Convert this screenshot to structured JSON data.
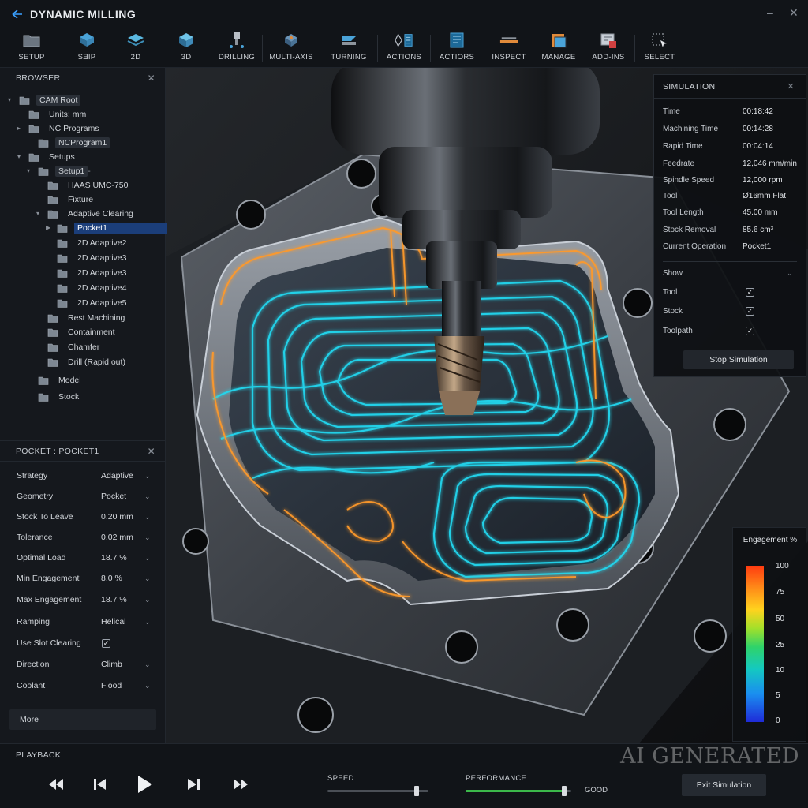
{
  "app": {
    "title": "DYNAMIC MILLING"
  },
  "toolbar": {
    "items": [
      {
        "label": "SETUP",
        "icon": "folder-icon"
      },
      {
        "label": "SƎIP",
        "icon": "stock-box-icon"
      },
      {
        "label": "2D",
        "icon": "2d-layer-icon"
      },
      {
        "label": "3D",
        "icon": "3d-cube-icon"
      },
      {
        "label": "DRILLING",
        "icon": "drill-icon"
      },
      {
        "label": "MULTI-AXIS",
        "icon": "multi-axis-icon"
      },
      {
        "label": "TURNING",
        "icon": "turning-icon"
      },
      {
        "label": "ACTIONS",
        "icon": "actions-icon"
      },
      {
        "label": "ACTIORS",
        "icon": "actions-panel-icon"
      },
      {
        "label": "INSPECT",
        "icon": "inspect-icon"
      },
      {
        "label": "MANAGE",
        "icon": "manage-icon"
      },
      {
        "label": "ADD-INS",
        "icon": "add-ins-icon"
      },
      {
        "label": "SELECT",
        "icon": "select-icon"
      }
    ]
  },
  "browser": {
    "title": "BROWSER",
    "tree": [
      {
        "label": "CAM Root",
        "depth": 0,
        "arrow": "▾",
        "boxed": true
      },
      {
        "label": "Units: mm",
        "depth": 1
      },
      {
        "label": "NC Programs",
        "depth": 1,
        "arrow": "▸"
      },
      {
        "label": "NCProgram1",
        "depth": 2,
        "boxed": true
      },
      {
        "label": "Setups",
        "depth": 1,
        "arrow": "▾"
      },
      {
        "label": "Setup1",
        "depth": 2,
        "arrow": "▾",
        "boxed": true,
        "suffix": " -"
      },
      {
        "label": "HAAS UMC-750",
        "depth": 3
      },
      {
        "label": "Fixture",
        "depth": 3
      },
      {
        "label": "Adaptive Clearing",
        "depth": 3,
        "arrow": "▾"
      },
      {
        "label": "Pocket1",
        "depth": 4,
        "arrow": "▶",
        "selected": true
      },
      {
        "label": "2D Adaptive2",
        "depth": 4
      },
      {
        "label": "2D Adaptive3",
        "depth": 4
      },
      {
        "label": "2D Adaptive3",
        "depth": 4
      },
      {
        "label": "2D Adaptive4",
        "depth": 4
      },
      {
        "label": "2D Adaptive5",
        "depth": 4
      },
      {
        "label": "Rest Machining",
        "depth": 3
      },
      {
        "label": "Containment",
        "depth": 3
      },
      {
        "label": "Chamfer",
        "depth": 3
      },
      {
        "label": "Drill (Rapid out)",
        "depth": 3
      },
      {
        "label": "Model",
        "depth": 2
      },
      {
        "label": "Stock",
        "depth": 2
      }
    ]
  },
  "pocket": {
    "title": "POCKET : POCKET1",
    "params": [
      {
        "label": "Strategy",
        "value": "Adaptive",
        "dropdown": true
      },
      {
        "label": "Geometry",
        "value": "Pocket",
        "dropdown": true
      },
      {
        "label": "Stock To Leave",
        "value": "0.20 mm",
        "dropdown": true
      },
      {
        "label": "Tolerance",
        "value": "0.02 mm",
        "dropdown": true
      },
      {
        "label": "Optimal Load",
        "value": "18.7 %",
        "dropdown": true
      },
      {
        "label": "Min Engagement",
        "value": "8.0 %",
        "dropdown": true
      },
      {
        "label": "Max Engagement",
        "value": "18.7 %",
        "dropdown": true
      },
      {
        "label": "Ramping",
        "value": "Helical",
        "dropdown": true
      },
      {
        "label": "Use Slot Clearing",
        "value": "",
        "checkbox": true,
        "checked": true
      },
      {
        "label": "Direction",
        "value": "Climb",
        "dropdown": true
      },
      {
        "label": "Coolant",
        "value": "Flood",
        "dropdown": true
      }
    ],
    "more_label": "More"
  },
  "simulation": {
    "title": "SIMULATION",
    "stats": [
      {
        "label": "Time",
        "value": "00:18:42"
      },
      {
        "label": "Machining Time",
        "value": "00:14:28"
      },
      {
        "label": "Rapid Time",
        "value": "00:04:14"
      },
      {
        "label": "Feedrate",
        "value": "12,046 mm/min"
      },
      {
        "label": "Spindle Speed",
        "value": "12,000 rpm"
      },
      {
        "label": "Tool",
        "value": "Ø16mm Flat"
      },
      {
        "label": "Tool Length",
        "value": "45.00 mm"
      },
      {
        "label": "Stock Removal",
        "value": "85.6 cm³"
      },
      {
        "label": "Current Operation",
        "value": "Pocket1"
      }
    ],
    "show_label": "Show",
    "show": [
      {
        "label": "Tool",
        "checked": true
      },
      {
        "label": "Stock",
        "checked": true
      },
      {
        "label": "Toolpath",
        "checked": true
      }
    ],
    "stop_label": "Stop Simulation"
  },
  "legend": {
    "title": "Engagement %",
    "ticks": [
      "100",
      "75",
      "50",
      "25",
      "10",
      "5",
      "0"
    ]
  },
  "playback": {
    "title": "PLAYBACK",
    "speed_label": "SPEED",
    "speed_level": 0.88,
    "performance_label": "PERFORMANCE",
    "performance_level": 0.93,
    "performance_value": "GOOD",
    "exit_label": "Exit Simulation",
    "watermark": "AI GENERATED"
  },
  "colors": {
    "toolpath_cyan": "#22d8f0",
    "toolpath_orange": "#ff9a2a",
    "selection_blue": "#1b3e7a",
    "performance_green": "#3bb84a"
  }
}
